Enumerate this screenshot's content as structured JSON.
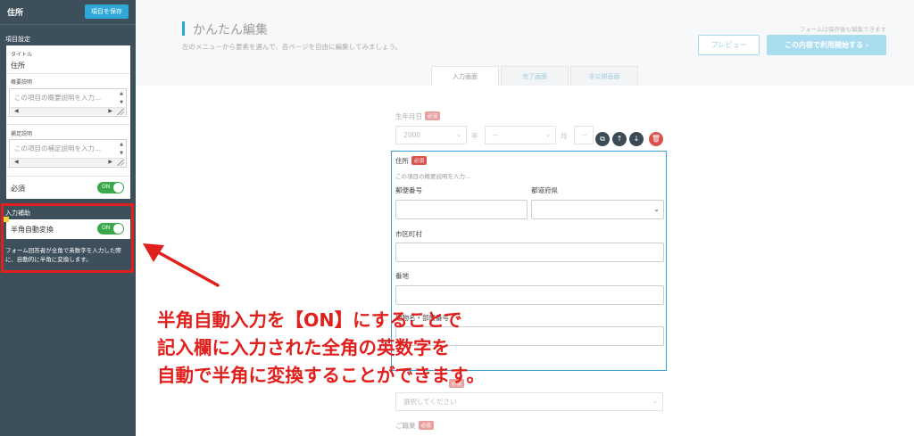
{
  "sidebar": {
    "title": "住所",
    "save_button": "項目を保存",
    "section_settings": "項目設定",
    "title_field": {
      "label": "タイトル",
      "value": "住所"
    },
    "summary_field": {
      "label": "概要説明",
      "placeholder": "この項目の概要説明を入力..."
    },
    "note_field": {
      "label": "補足説明",
      "placeholder": "この項目の補足説明を入力..."
    },
    "required": {
      "label": "必須",
      "toggle": "ON"
    },
    "section_assist": "入力補助",
    "halfwidth": {
      "label": "半角自動変換",
      "toggle": "ON"
    },
    "halfwidth_help": "フォーム回答者が全角で英数字を入力した際に、自動的に半角に変換します。"
  },
  "header": {
    "title": "かんたん編集",
    "subtitle": "左のメニューから要素を選んで、各ページを自由に編集してみましょう。",
    "edit_note": "フォームは保存後も編集できます",
    "preview_button": "プレビュー",
    "start_button": "この内容で利用開始する ›"
  },
  "tabs": [
    {
      "label": "入力画面",
      "active": true
    },
    {
      "label": "完了画面",
      "active": false
    },
    {
      "label": "非公開画面",
      "active": false
    }
  ],
  "form": {
    "birthday": {
      "label": "生年月日",
      "required": "必須",
      "year_value": "2000",
      "year_unit": "年",
      "month_value": "--",
      "month_unit": "月",
      "day_value": "--"
    },
    "address": {
      "label": "住所",
      "required": "必須",
      "description": "この項目の概要説明を入力...",
      "postal_label": "郵便番号",
      "prefecture_label": "都道府県",
      "city_label": "市区町村",
      "street_label": "番地",
      "building_label": "建物名・部屋番号"
    },
    "next_field": {
      "required": "必須",
      "placeholder": "選択してください"
    },
    "occupation": {
      "label": "ご職業",
      "required": "必須"
    }
  },
  "annotation": {
    "line1": "半角自動入力を【ON】にすることで",
    "line2": "記入欄に入力された全角の英数字を",
    "line3": "自動で半角に変換することができます。"
  },
  "colors": {
    "accent": "#2fa8d8",
    "toggle_on": "#3aa74b",
    "annotation": "#e0201c",
    "sidebar_bg": "#3d4f5b"
  }
}
